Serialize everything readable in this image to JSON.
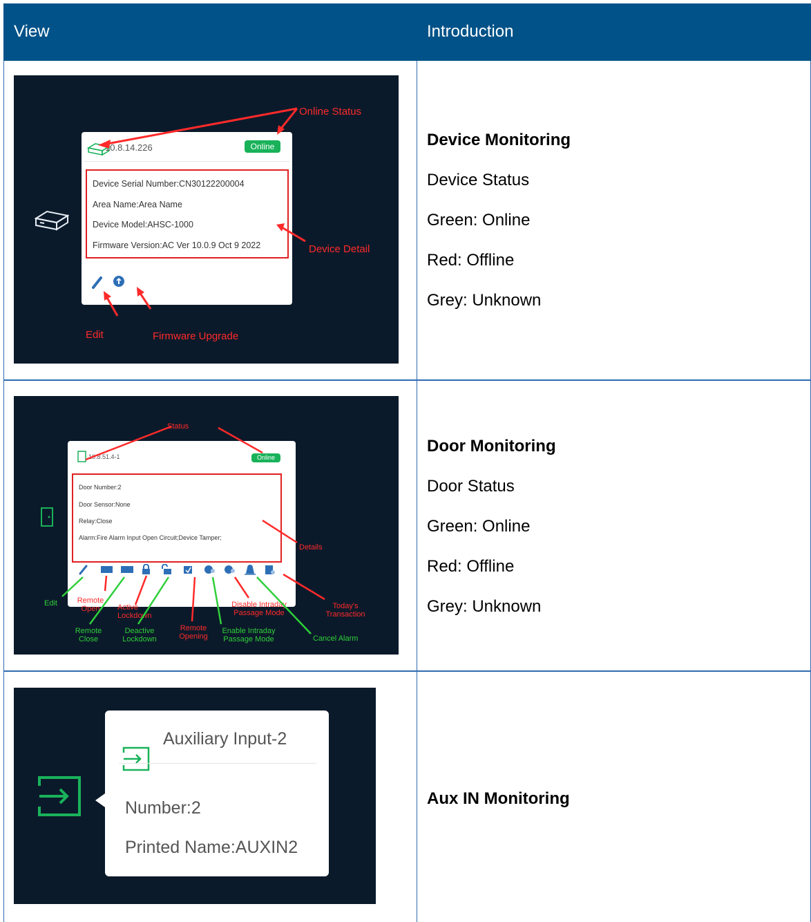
{
  "header": {
    "view": "View",
    "introduction": "Introduction"
  },
  "rows": [
    {
      "title": "Device Monitoring",
      "lines": [
        "Device Status",
        "Green: Online",
        "Red: Offline",
        "Grey: Unknown"
      ],
      "shot": {
        "ip": "10.8.14.226",
        "status": "Online",
        "details": [
          "Device Serial Number:CN30122200004",
          "Area Name:Area Name",
          "Device Model:AHSC-1000",
          "Firmware Version:AC Ver 10.0.9 Oct 9 2022"
        ],
        "annotations": {
          "online_status": "Online Status",
          "device_detail": "Device Detail",
          "edit": "Edit",
          "firmware_upgrade": "Firmware Upgrade"
        }
      }
    },
    {
      "title": "Door Monitoring",
      "lines": [
        "Door Status",
        "Green: Online",
        "Red: Offline",
        "Grey: Unknown"
      ],
      "shot": {
        "ip": "10.8.51.4-1",
        "status": "Online",
        "details": [
          "Door Number:2",
          "Door Sensor:None",
          "Relay:Close",
          "Alarm:Fire Alarm Input Open Circuit;Device Tamper;"
        ],
        "annotations": {
          "status": "Status",
          "details": "Details",
          "edit": "Edit",
          "remote_open": "Remote Open",
          "active_lockdown": "Active Lockdown",
          "remote_opening": "Remote Opening",
          "disable_intraday": "Disable Intraday Passage Mode",
          "todays_transaction": "Today's Transaction",
          "remote_close": "Remote Close",
          "deactive_lockdown": "Deactive Lockdown",
          "enable_intraday": "Enable Intraday Passage Mode",
          "cancel_alarm": "Cancel Alarm"
        },
        "btn_open": "OPEN",
        "btn_close": "CLOSE"
      }
    },
    {
      "title": "Aux IN Monitoring",
      "lines": [],
      "shot": {
        "name": "Auxiliary Input-2",
        "number": "Number:2",
        "printed_name": "Printed Name:AUXIN2"
      }
    }
  ],
  "colors": {
    "header": "#005288",
    "grid": "#2f6bb0",
    "online": "#19b25a",
    "annotation_red": "#ff2a2a",
    "annotation_green": "#2fcf3a",
    "screen_bg": "#0b1a2a"
  }
}
